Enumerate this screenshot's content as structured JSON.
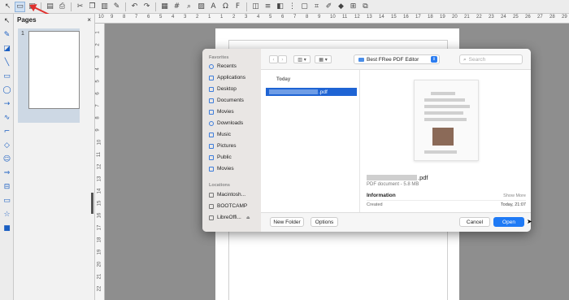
{
  "colors": {
    "accent": "#1f7af5",
    "selection": "#1f64d4",
    "annotation_arrow": "#e0302d"
  },
  "toolbar": {
    "icons": [
      "cursor-icon",
      "new-icon",
      "save-icon",
      "export-pdf-icon",
      "print-icon",
      "cut-icon",
      "copy-icon",
      "paste-icon",
      "clone-icon",
      "undo-icon",
      "redo-icon",
      "table-icon",
      "grid-icon",
      "zoom-icon",
      "image-icon",
      "textbox-icon",
      "special-character-icon",
      "fontwork-icon",
      "transform-icon",
      "align-icon",
      "arrange-icon",
      "distribute-icon",
      "shadow-icon",
      "crop-icon",
      "filter-icon",
      "points-icon",
      "glue-icon",
      "toggle-extrusion-icon"
    ]
  },
  "pages_panel": {
    "title": "Pages",
    "close": "×",
    "page_number": "1"
  },
  "hruler_ticks": [
    "10",
    "9",
    "8",
    "7",
    "6",
    "5",
    "4",
    "3",
    "2",
    "1",
    "1",
    "2",
    "3",
    "4",
    "5",
    "6",
    "7",
    "8",
    "9",
    "10",
    "11",
    "12",
    "13",
    "14",
    "15",
    "16",
    "17",
    "18",
    "19",
    "20",
    "21",
    "22",
    "23",
    "24",
    "25",
    "26",
    "27",
    "28",
    "29"
  ],
  "vruler_ticks": [
    "1",
    "2",
    "3",
    "4",
    "5",
    "6",
    "7",
    "8",
    "9",
    "10",
    "11",
    "12",
    "13",
    "14",
    "15",
    "16",
    "17",
    "18",
    "19",
    "20",
    "21",
    "22"
  ],
  "dialog": {
    "sidebar": {
      "favorites_heading": "Favorites",
      "favorites": [
        "Recents",
        "Applications",
        "Desktop",
        "Documents",
        "Movies",
        "Downloads",
        "Music",
        "Pictures",
        "Public",
        "Movies"
      ],
      "locations_heading": "Locations",
      "locations": [
        "Macintosh...",
        "BOOTCAMP",
        "LibreOffi..."
      ]
    },
    "location": "Best FRee PDF Editor",
    "search_placeholder": "Search",
    "section_today": "Today",
    "selected_file_suffix": ".pdf",
    "preview": {
      "name_suffix": ".pdf",
      "kind_size": "PDF document - 5.8 MB",
      "info_heading": "Information",
      "show_more": "Show More",
      "created_label": "Created",
      "created_value": "Today, 21:07"
    },
    "buttons": {
      "new_folder": "New Folder",
      "options": "Options",
      "cancel": "Cancel",
      "open": "Open"
    }
  }
}
